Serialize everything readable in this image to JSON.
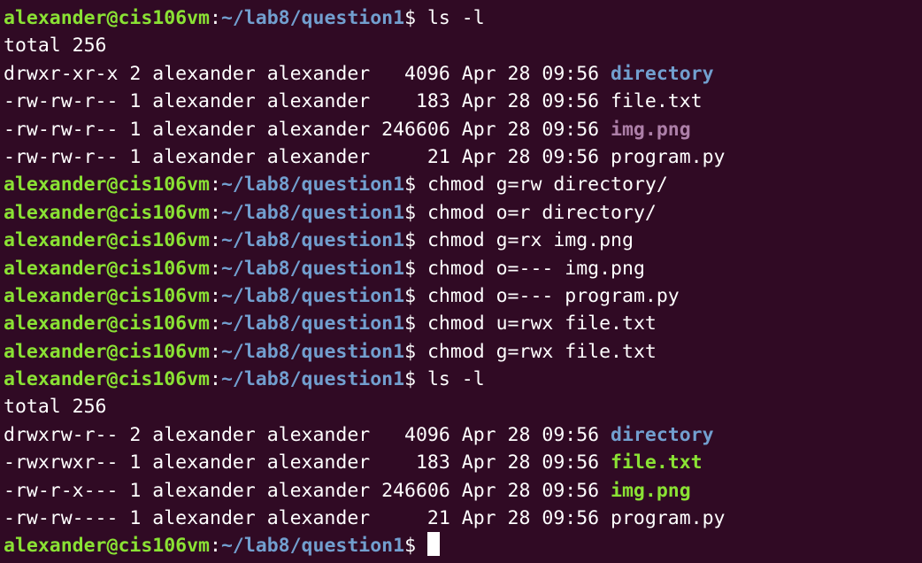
{
  "colors": {
    "background": "#300a24",
    "prompt_user": "#8ae234",
    "prompt_path": "#729fcf",
    "text": "#ffffff",
    "directory": "#729fcf",
    "image_file": "#ad7fa8",
    "executable": "#8ae234"
  },
  "prompt": {
    "user_host": "alexander@cis106vm",
    "colon": ":",
    "path": "~/lab8/question1",
    "dollar": "$ "
  },
  "lines": [
    {
      "type": "prompt",
      "command": "ls -l"
    },
    {
      "type": "output",
      "text": "total 256"
    },
    {
      "type": "listing",
      "meta": "drwxr-xr-x 2 alexander alexander   4096 Apr 28 09:56 ",
      "filename": "directory",
      "style": "dir"
    },
    {
      "type": "listing",
      "meta": "-rw-rw-r-- 1 alexander alexander    183 Apr 28 09:56 ",
      "filename": "file.txt",
      "style": "plain"
    },
    {
      "type": "listing",
      "meta": "-rw-rw-r-- 1 alexander alexander 246606 Apr 28 09:56 ",
      "filename": "img.png",
      "style": "img"
    },
    {
      "type": "listing",
      "meta": "-rw-rw-r-- 1 alexander alexander     21 Apr 28 09:56 ",
      "filename": "program.py",
      "style": "plain"
    },
    {
      "type": "prompt",
      "command": "chmod g=rw directory/"
    },
    {
      "type": "prompt",
      "command": "chmod o=r directory/"
    },
    {
      "type": "prompt",
      "command": "chmod g=rx img.png"
    },
    {
      "type": "prompt",
      "command": "chmod o=--- img.png"
    },
    {
      "type": "prompt",
      "command": "chmod o=--- program.py"
    },
    {
      "type": "prompt",
      "command": "chmod u=rwx file.txt"
    },
    {
      "type": "prompt",
      "command": "chmod g=rwx file.txt"
    },
    {
      "type": "prompt",
      "command": "ls -l"
    },
    {
      "type": "output",
      "text": "total 256"
    },
    {
      "type": "listing",
      "meta": "drwxrw-r-- 2 alexander alexander   4096 Apr 28 09:56 ",
      "filename": "directory",
      "style": "dir"
    },
    {
      "type": "listing",
      "meta": "-rwxrwxr-- 1 alexander alexander    183 Apr 28 09:56 ",
      "filename": "file.txt",
      "style": "exec"
    },
    {
      "type": "listing",
      "meta": "-rw-r-x--- 1 alexander alexander 246606 Apr 28 09:56 ",
      "filename": "img.png",
      "style": "exec"
    },
    {
      "type": "listing",
      "meta": "-rw-rw---- 1 alexander alexander     21 Apr 28 09:56 ",
      "filename": "program.py",
      "style": "plain"
    },
    {
      "type": "prompt",
      "command": "",
      "cursor": true
    }
  ]
}
